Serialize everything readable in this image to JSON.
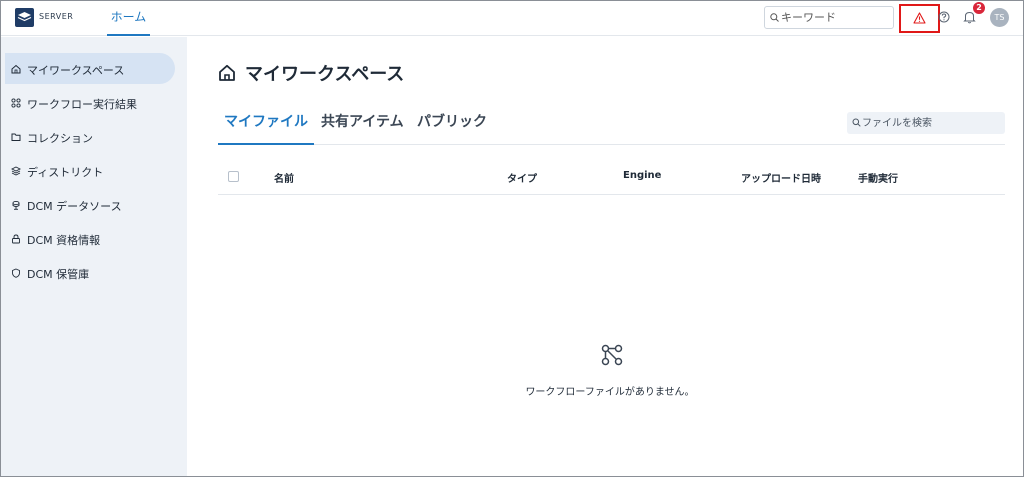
{
  "header": {
    "brand": "SERVER",
    "home_tab": "ホーム",
    "search_placeholder": "キーワード",
    "notification_count": "2",
    "avatar_initials": "TS"
  },
  "sidebar": {
    "items": [
      {
        "label": "マイワークスペース",
        "icon": "home-icon",
        "active": true
      },
      {
        "label": "ワークフロー実行結果",
        "icon": "workflow-icon"
      },
      {
        "label": "コレクション",
        "icon": "folder-icon"
      },
      {
        "label": "ディストリクト",
        "icon": "layers-icon"
      },
      {
        "label": "DCM データソース",
        "icon": "datasource-icon"
      },
      {
        "label": "DCM 資格情報",
        "icon": "lock-icon"
      },
      {
        "label": "DCM 保管庫",
        "icon": "shield-icon"
      }
    ]
  },
  "main": {
    "title": "マイワークスペース",
    "tabs": [
      "マイファイル",
      "共有アイテム",
      "パブリック"
    ],
    "file_search_placeholder": "ファイルを検索",
    "columns": [
      "名前",
      "タイプ",
      "Engine",
      "アップロード日時",
      "手動実行"
    ],
    "empty_message": "ワークフローファイルがありません。"
  },
  "colors": {
    "accent": "#1f78c1",
    "alert_highlight": "#e01818",
    "badge": "#d9263a",
    "sidebar_bg": "#eef2f7"
  }
}
